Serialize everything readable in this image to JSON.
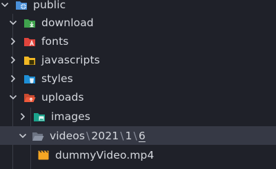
{
  "tree": {
    "public": {
      "label": "public"
    },
    "download": {
      "label": "download"
    },
    "fonts": {
      "label": "fonts"
    },
    "javascripts": {
      "label": "javascripts"
    },
    "styles": {
      "label": "styles"
    },
    "uploads": {
      "label": "uploads"
    },
    "images": {
      "label": "images"
    },
    "videos_path": {
      "segments": [
        "videos",
        "2021",
        "1",
        "6"
      ],
      "separator": "\\"
    },
    "dummy_video": {
      "label": "dummyVideo.mp4"
    }
  },
  "colors": {
    "background": "#1f2129",
    "selected_row": "#363945",
    "public_folder": "#4a90d9",
    "download_folder": "#3fa34d",
    "fonts_folder": "#e0443c",
    "javascripts_folder": "#f2b824",
    "styles_folder": "#1e8fd6",
    "uploads_folder": "#ef5a3c",
    "images_folder": "#1aa38c",
    "videos_folder": "#8b93a3",
    "video_file": "#f5a623"
  }
}
